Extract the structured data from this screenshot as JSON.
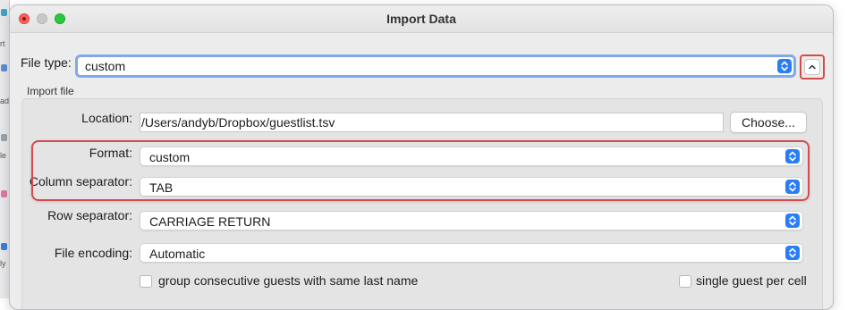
{
  "window": {
    "title": "Import Data"
  },
  "background_app": {
    "fragments": [
      "rt",
      "ad",
      "le",
      "ly"
    ]
  },
  "file_type": {
    "label": "File type:",
    "value": "custom"
  },
  "import_file": {
    "section_title": "Import file",
    "location": {
      "label": "Location:",
      "value": "/Users/andyb/Dropbox/guestlist.tsv",
      "choose_label": "Choose..."
    },
    "format": {
      "label": "Format:",
      "value": "custom"
    },
    "column_separator": {
      "label": "Column separator:",
      "value": "TAB"
    },
    "row_separator": {
      "label": "Row separator:",
      "value": "CARRIAGE RETURN"
    },
    "file_encoding": {
      "label": "File encoding:",
      "value": "Automatic"
    },
    "options": {
      "group_consecutive": "group consecutive guests with same last name",
      "single_guest": "single guest per cell"
    }
  },
  "colors": {
    "accent": "#2a7ef5",
    "annotation": "#d64a4a",
    "focus_ring": "#7fa9e8"
  },
  "icons": {
    "stepper": "up-down-chevrons-icon",
    "collapse": "chevron-up-icon"
  }
}
